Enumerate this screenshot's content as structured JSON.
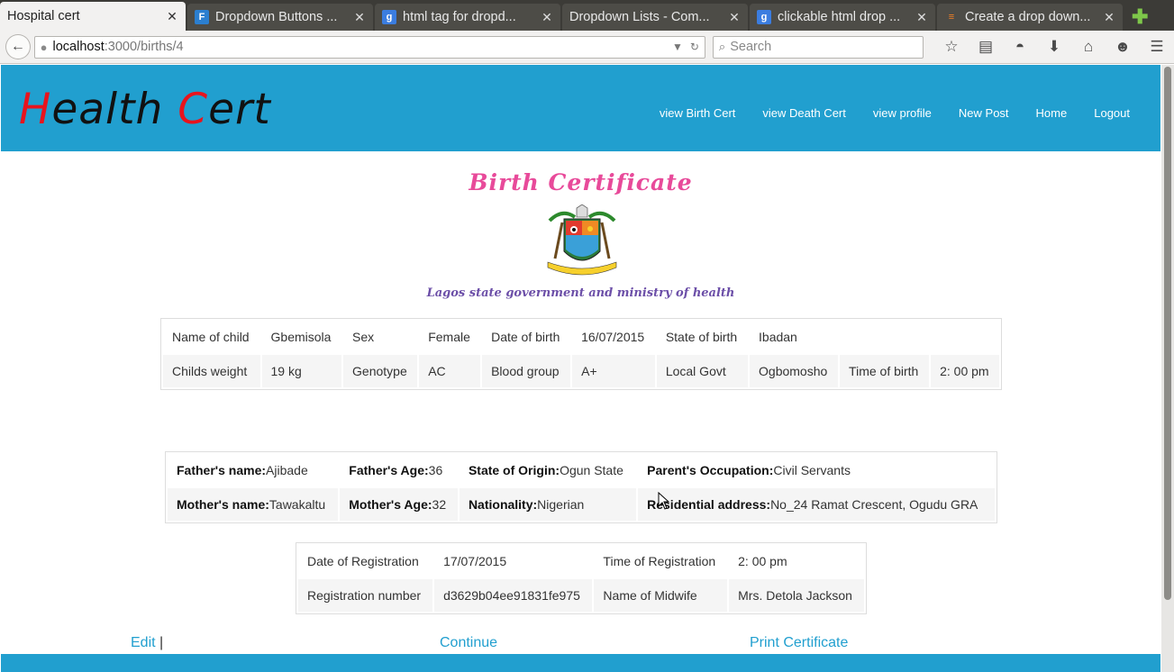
{
  "browser": {
    "tabs": [
      {
        "title": "Hospital cert",
        "icon": "page-icon",
        "active": true
      },
      {
        "title": "Dropdown Buttons ...",
        "icon": "f-icon",
        "color": "#2b7fd0"
      },
      {
        "title": "html tag for dropd...",
        "icon": "google-icon",
        "color": "#3b7de0"
      },
      {
        "title": "Dropdown Lists - Com...",
        "icon": "page-icon"
      },
      {
        "title": "clickable html drop ...",
        "icon": "google-icon",
        "color": "#3b7de0"
      },
      {
        "title": "Create a drop down...",
        "icon": "stackoverflow-icon",
        "color": "#f48024"
      }
    ],
    "url_host": "localhost",
    "url_path": ":3000/births/4",
    "search_placeholder": "Search"
  },
  "site": {
    "brand_parts": [
      "H",
      "ealth ",
      "C",
      "ert"
    ],
    "accent_color": "#219fcf",
    "nav": [
      "view Birth Cert",
      "view Death Cert",
      "view profile",
      "New Post",
      "Home",
      "Logout"
    ]
  },
  "certificate": {
    "title": "Birth Certificate",
    "subtitle": "Lagos state government and  ministry of health"
  },
  "child": {
    "name_label": "Name of child",
    "name": "Gbemisola",
    "sex_label": "Sex",
    "sex": "Female",
    "dob_label": "Date of birth",
    "dob": "16/07/2015",
    "state_label": "State of birth",
    "state": "Ibadan",
    "weight_label": "Childs weight",
    "weight": "19 kg",
    "genotype_label": "Genotype",
    "genotype": "AC",
    "blood_label": "Blood group",
    "blood": "A+",
    "lga_label": "Local Govt",
    "lga": "Ogbomosho",
    "tob_label": "Time of birth",
    "tob": "2: 00 pm"
  },
  "parents": {
    "father_name_label": "Father's name:",
    "father_name": "Ajibade",
    "father_age_label": "Father's Age:",
    "father_age": "36",
    "origin_label": "State of Origin:",
    "origin": "Ogun State",
    "occupation_label": "Parent's Occupation:",
    "occupation": "Civil Servants",
    "mother_name_label": "Mother's name:",
    "mother_name": "Tawakaltu",
    "mother_age_label": "Mother's Age:",
    "mother_age": "32",
    "nationality_label": "Nationality:",
    "nationality": "Nigerian",
    "address_label": "Residential address:",
    "address": "No_24 Ramat Crescent, Ogudu GRA"
  },
  "registration": {
    "date_label": "Date of Registration",
    "date": "17/07/2015",
    "time_label": "Time of Registration",
    "time": "2: 00 pm",
    "number_label": "Registration number",
    "number": "d3629b04ee91831fe975",
    "midwife_label": "Name of Midwife",
    "midwife": "Mrs. Detola Jackson"
  },
  "actions": {
    "edit": "Edit",
    "separator": "|",
    "continue": "Continue",
    "print": "Print Certificate"
  }
}
